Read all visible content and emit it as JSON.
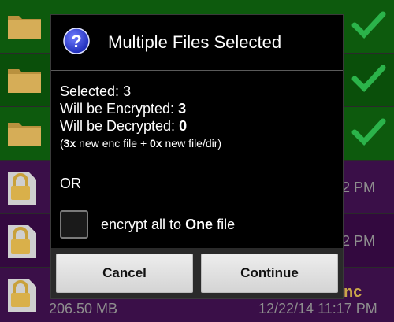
{
  "background": {
    "rows": [
      {
        "kind": "folder",
        "color": "green"
      },
      {
        "kind": "folder",
        "color": "green"
      },
      {
        "kind": "folder",
        "color": "green"
      },
      {
        "kind": "locked",
        "color": "purple",
        "time_fragment": "2 PM"
      },
      {
        "kind": "locked",
        "color": "purple",
        "time_fragment": "2 PM"
      },
      {
        "kind": "locked",
        "color": "purple",
        "name_fragment": "nc",
        "size": "206.50 MB",
        "date": "12/22/14 11:17 PM"
      }
    ]
  },
  "dialog": {
    "title": "Multiple Files Selected",
    "selected_label": "Selected: ",
    "selected_count": "3",
    "encrypted_label": "Will be Encrypted: ",
    "encrypted_count": "3",
    "decrypted_label": "Will be Decrypted: ",
    "decrypted_count": "0",
    "summary_open": "(",
    "summary_enc_count": "3x",
    "summary_enc_text": " new enc file + ",
    "summary_new_count": "0x",
    "summary_new_text": " new file/dir)",
    "or_text": "OR",
    "checkbox_prefix": "encrypt all to ",
    "checkbox_bold": "One",
    "checkbox_suffix": " file",
    "checkbox_checked": false,
    "cancel_label": "Cancel",
    "continue_label": "Continue"
  },
  "colors": {
    "help_icon": "#2f3fd0",
    "check_icon": "#2bb34a",
    "folder_icon": "#caa04a"
  }
}
